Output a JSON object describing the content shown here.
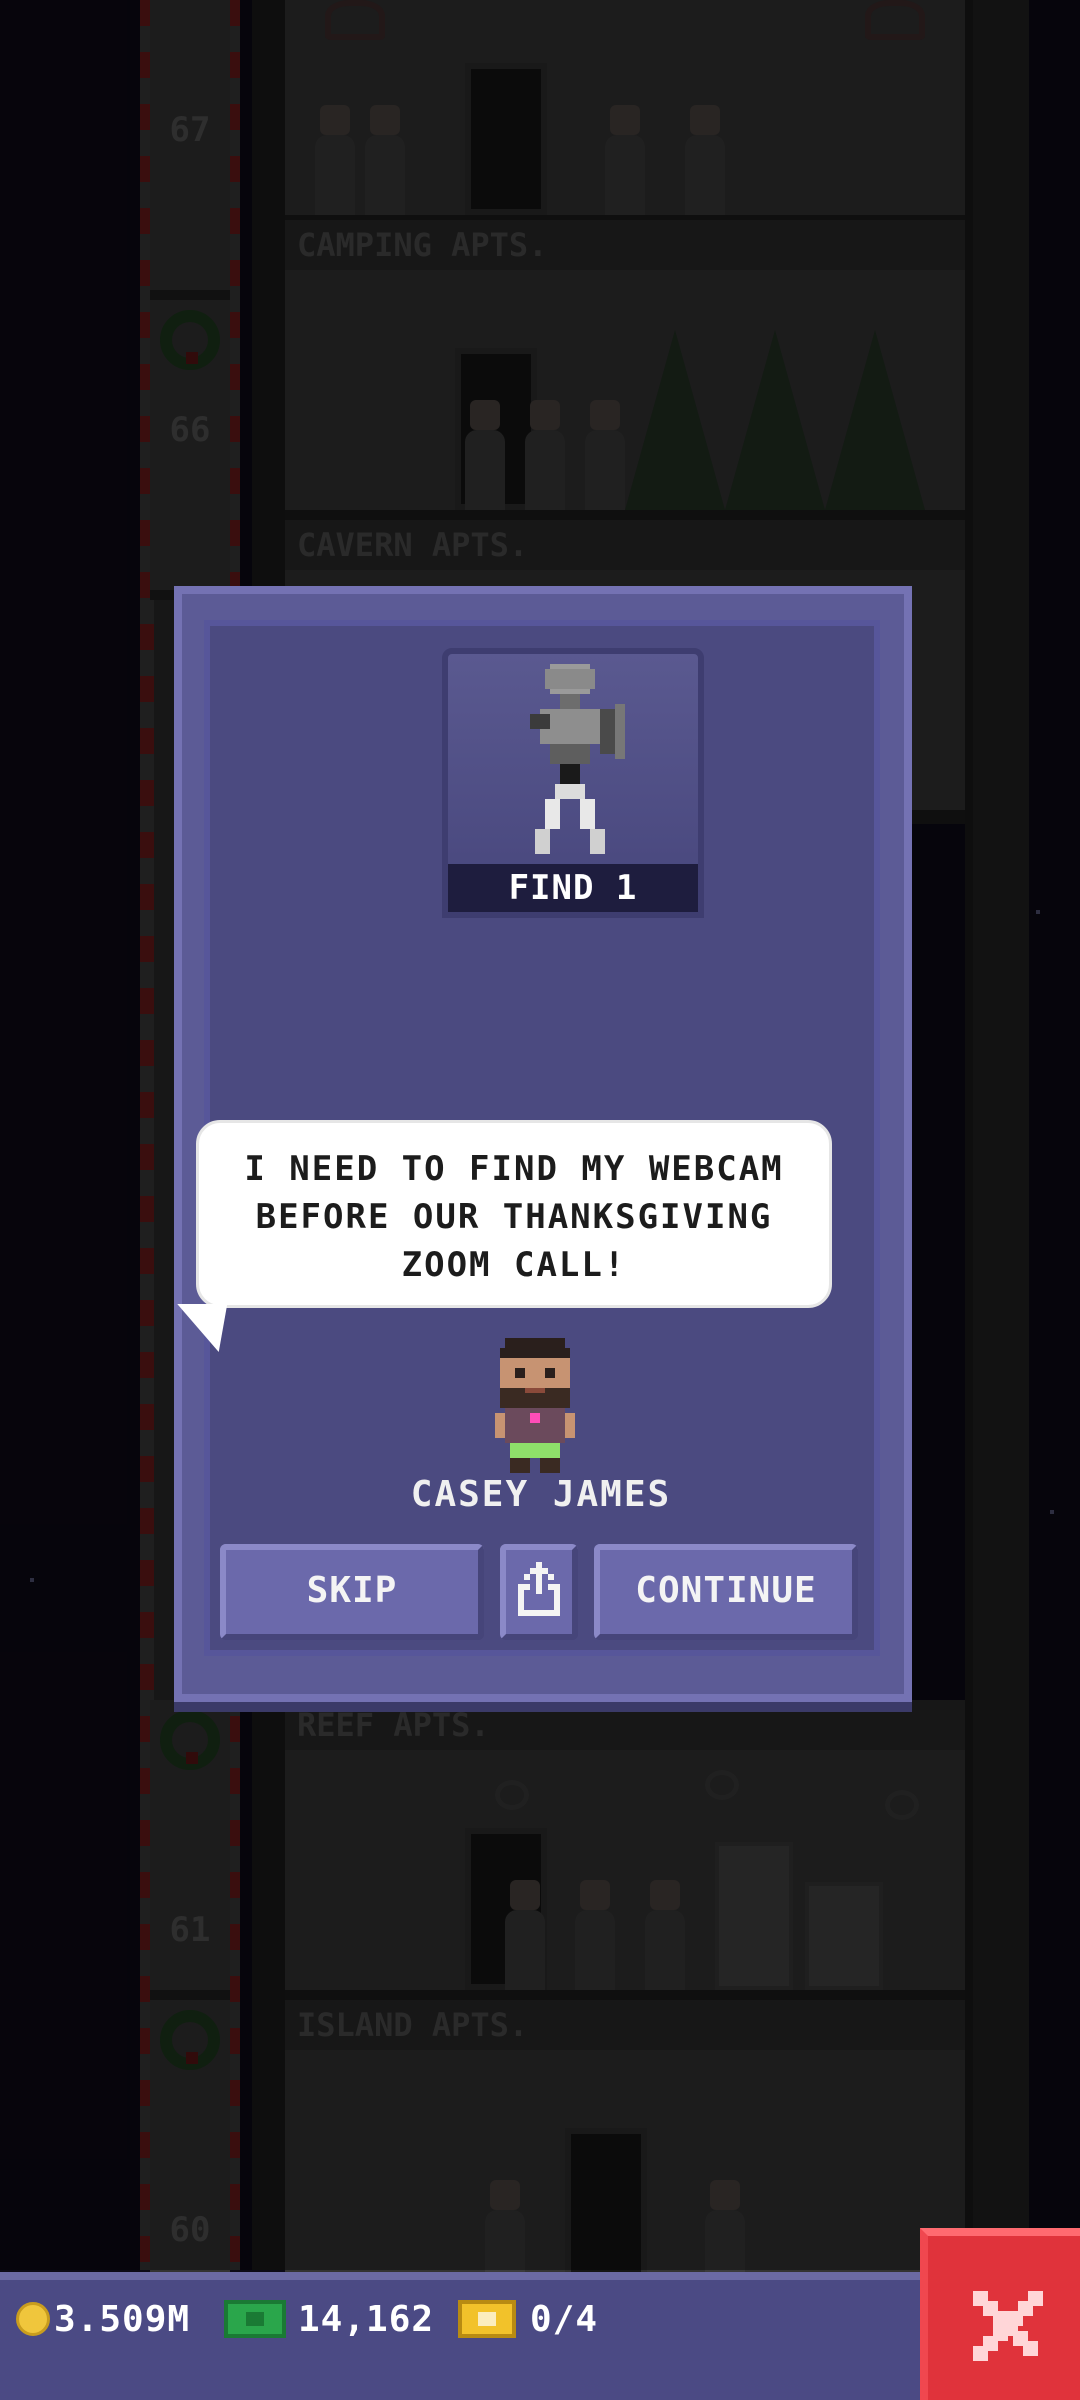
{
  "tower": {
    "floors": [
      {
        "number": "67",
        "label": "CAMPING APTS."
      },
      {
        "number": "66",
        "label": "CAVERN APTS."
      },
      {
        "number": "61",
        "label": "REEF APTS."
      },
      {
        "number": "60",
        "label": "ISLAND APTS."
      }
    ]
  },
  "dialog": {
    "item_label": "FIND 1",
    "item_icon": "webcam-icon",
    "speech_lines": [
      "I NEED TO FIND MY WEBCAM",
      "BEFORE OUR THANKSGIVING",
      "ZOOM CALL!"
    ],
    "character_name": "CASEY JAMES",
    "skip_label": "SKIP",
    "share_icon": "share-icon",
    "continue_label": "CONTINUE"
  },
  "hud": {
    "coins": "3.509M",
    "cash": "14,162",
    "tickets": "0/4",
    "close_icon": "close-icon"
  },
  "colors": {
    "dialog_bg": "#5c5b96",
    "button_bg": "#6b69ab",
    "close_red": "#e0333b"
  }
}
